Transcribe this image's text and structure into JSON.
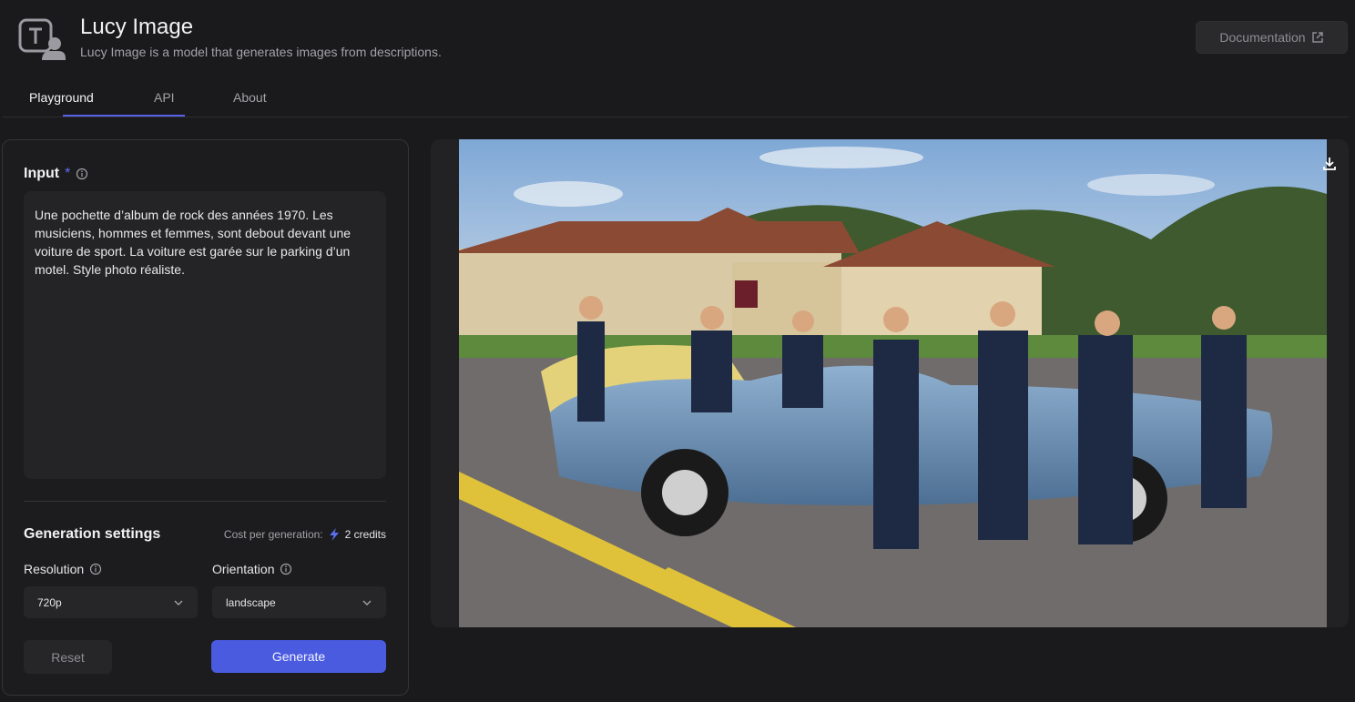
{
  "app": {
    "title": "Lucy Image",
    "subtitle": "Lucy Image is a model that generates images from descriptions.",
    "documentation_label": "Documentation"
  },
  "tabs": [
    {
      "label": "Playground",
      "active": true
    },
    {
      "label": "API",
      "active": false
    },
    {
      "label": "About",
      "active": false
    }
  ],
  "input": {
    "label": "Input",
    "required_marker": "*",
    "prompt": "Une pochette d’album de rock des années 1970. Les musiciens, hommes et femmes, sont debout devant une voiture de sport. La voiture est garée sur le parking d’un motel. Style photo réaliste."
  },
  "settings": {
    "title": "Generation settings",
    "cost_label": "Cost per generation:",
    "cost_value": "2 credits",
    "resolution_label": "Resolution",
    "resolution_value": "720p",
    "orientation_label": "Orientation",
    "orientation_value": "landscape"
  },
  "actions": {
    "reset": "Reset",
    "generate": "Generate"
  },
  "colors": {
    "accent": "#4a5be0",
    "background": "#1a191b"
  },
  "icons": {
    "logo": "text-to-image-logo-icon",
    "external": "external-link-icon",
    "info": "info-icon",
    "bolt": "lightning-bolt-icon",
    "chevron": "chevron-down-icon",
    "download": "download-icon"
  }
}
